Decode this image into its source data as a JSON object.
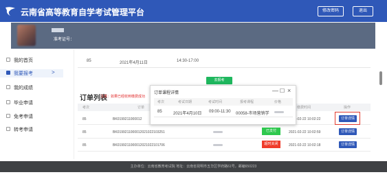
{
  "header": {
    "title": "云南省高等教育自学考试管理平台",
    "change_password": "修改密码",
    "logout": "退出"
  },
  "user": {
    "id_label": "准考证号："
  },
  "sidebar": {
    "items": [
      {
        "label": "我的首页"
      },
      {
        "label": "我要报考",
        "arrow": ">"
      },
      {
        "label": "我的成绩"
      },
      {
        "label": "毕业申请"
      },
      {
        "label": "免考申请"
      },
      {
        "label": "转考申请"
      }
    ]
  },
  "exam_row": {
    "no": "85",
    "date": "2021年4月11日",
    "time": "14:30-17:00"
  },
  "green_tag": "去报考",
  "orders": {
    "title": "订单列表",
    "note": "注意：如果已经收到缴费成功",
    "headers": [
      "考次",
      "订单",
      "操作"
    ],
    "paid_time_header": "缴费时间",
    "rows": [
      {
        "exam": "85",
        "order": "BK0199211000012",
        "time": "2021-02-22 10:02:22",
        "action": "订单详情"
      },
      {
        "exam": "85",
        "order": "BK0199211000012021022103251",
        "status": "已支付",
        "time": "2021-02-22 10:02:59",
        "action": "订单详情"
      },
      {
        "exam": "85",
        "order": "BK0199211000012021022101706",
        "status": "超时关闭",
        "time": "2021-02-22 10:02:18",
        "action": "订单详情"
      }
    ]
  },
  "modal": {
    "title": "订单课程详情",
    "controls": {
      "min": "—",
      "max": "☐",
      "close": "×"
    },
    "headers": [
      "考次",
      "考试日期",
      "考试时间",
      "报考课程",
      "价格"
    ],
    "row": {
      "exam": "85",
      "date": "2021年4月10日",
      "time": "09:00-11:30",
      "course": "00058-市场营销学"
    }
  },
  "footer": {
    "text": "主办单位：云南省教育考试院 地址：云南省昆明市五华区学府路61号，邮编650223"
  },
  "colors": {
    "brand": "#2f58b8",
    "paid": "#2ec84e",
    "timeout": "#ef3b2a",
    "highlight": "#e23b2f"
  }
}
